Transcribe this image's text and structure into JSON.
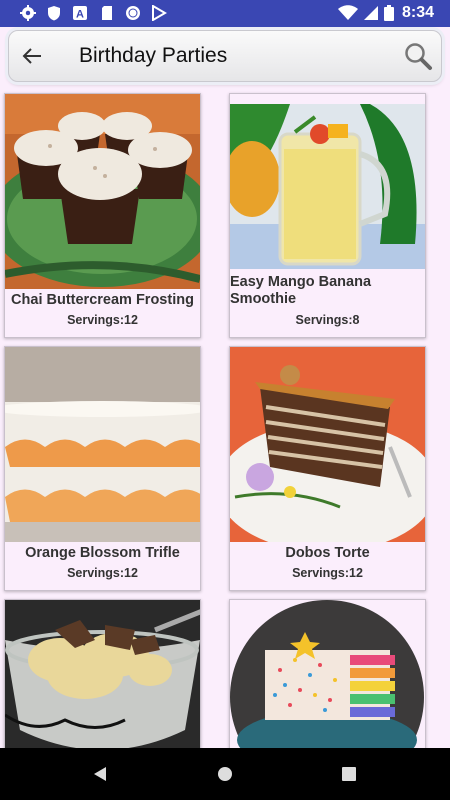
{
  "status_bar": {
    "time": "8:34",
    "icons": [
      "gear-icon",
      "shield-icon",
      "a-icon",
      "sd-card-icon",
      "circle-icon",
      "play-store-icon",
      "wifi-icon",
      "battery-icon"
    ]
  },
  "app_bar": {
    "title": "Birthday Parties",
    "back_icon": "arrow-left-icon",
    "search_icon": "magnifier-icon"
  },
  "recipes": [
    {
      "name": "Chai Buttercream Frosting",
      "servings": "Servings:12",
      "photo": "cupcakes"
    },
    {
      "name": "Easy Mango Banana Smoothie",
      "servings": "Servings:8",
      "photo": "smoothie"
    },
    {
      "name": "Orange Blossom Trifle",
      "servings": "Servings:12",
      "photo": "trifle"
    },
    {
      "name": "Dobos Torte",
      "servings": "Servings:12",
      "photo": "torte"
    },
    {
      "name": "",
      "servings": "",
      "photo": "ice-cream"
    },
    {
      "name": "",
      "servings": "",
      "photo": "sprinkle-cake"
    }
  ],
  "nav_bar": {
    "icons": [
      "back-triangle-icon",
      "home-circle-icon",
      "recents-square-icon"
    ]
  }
}
